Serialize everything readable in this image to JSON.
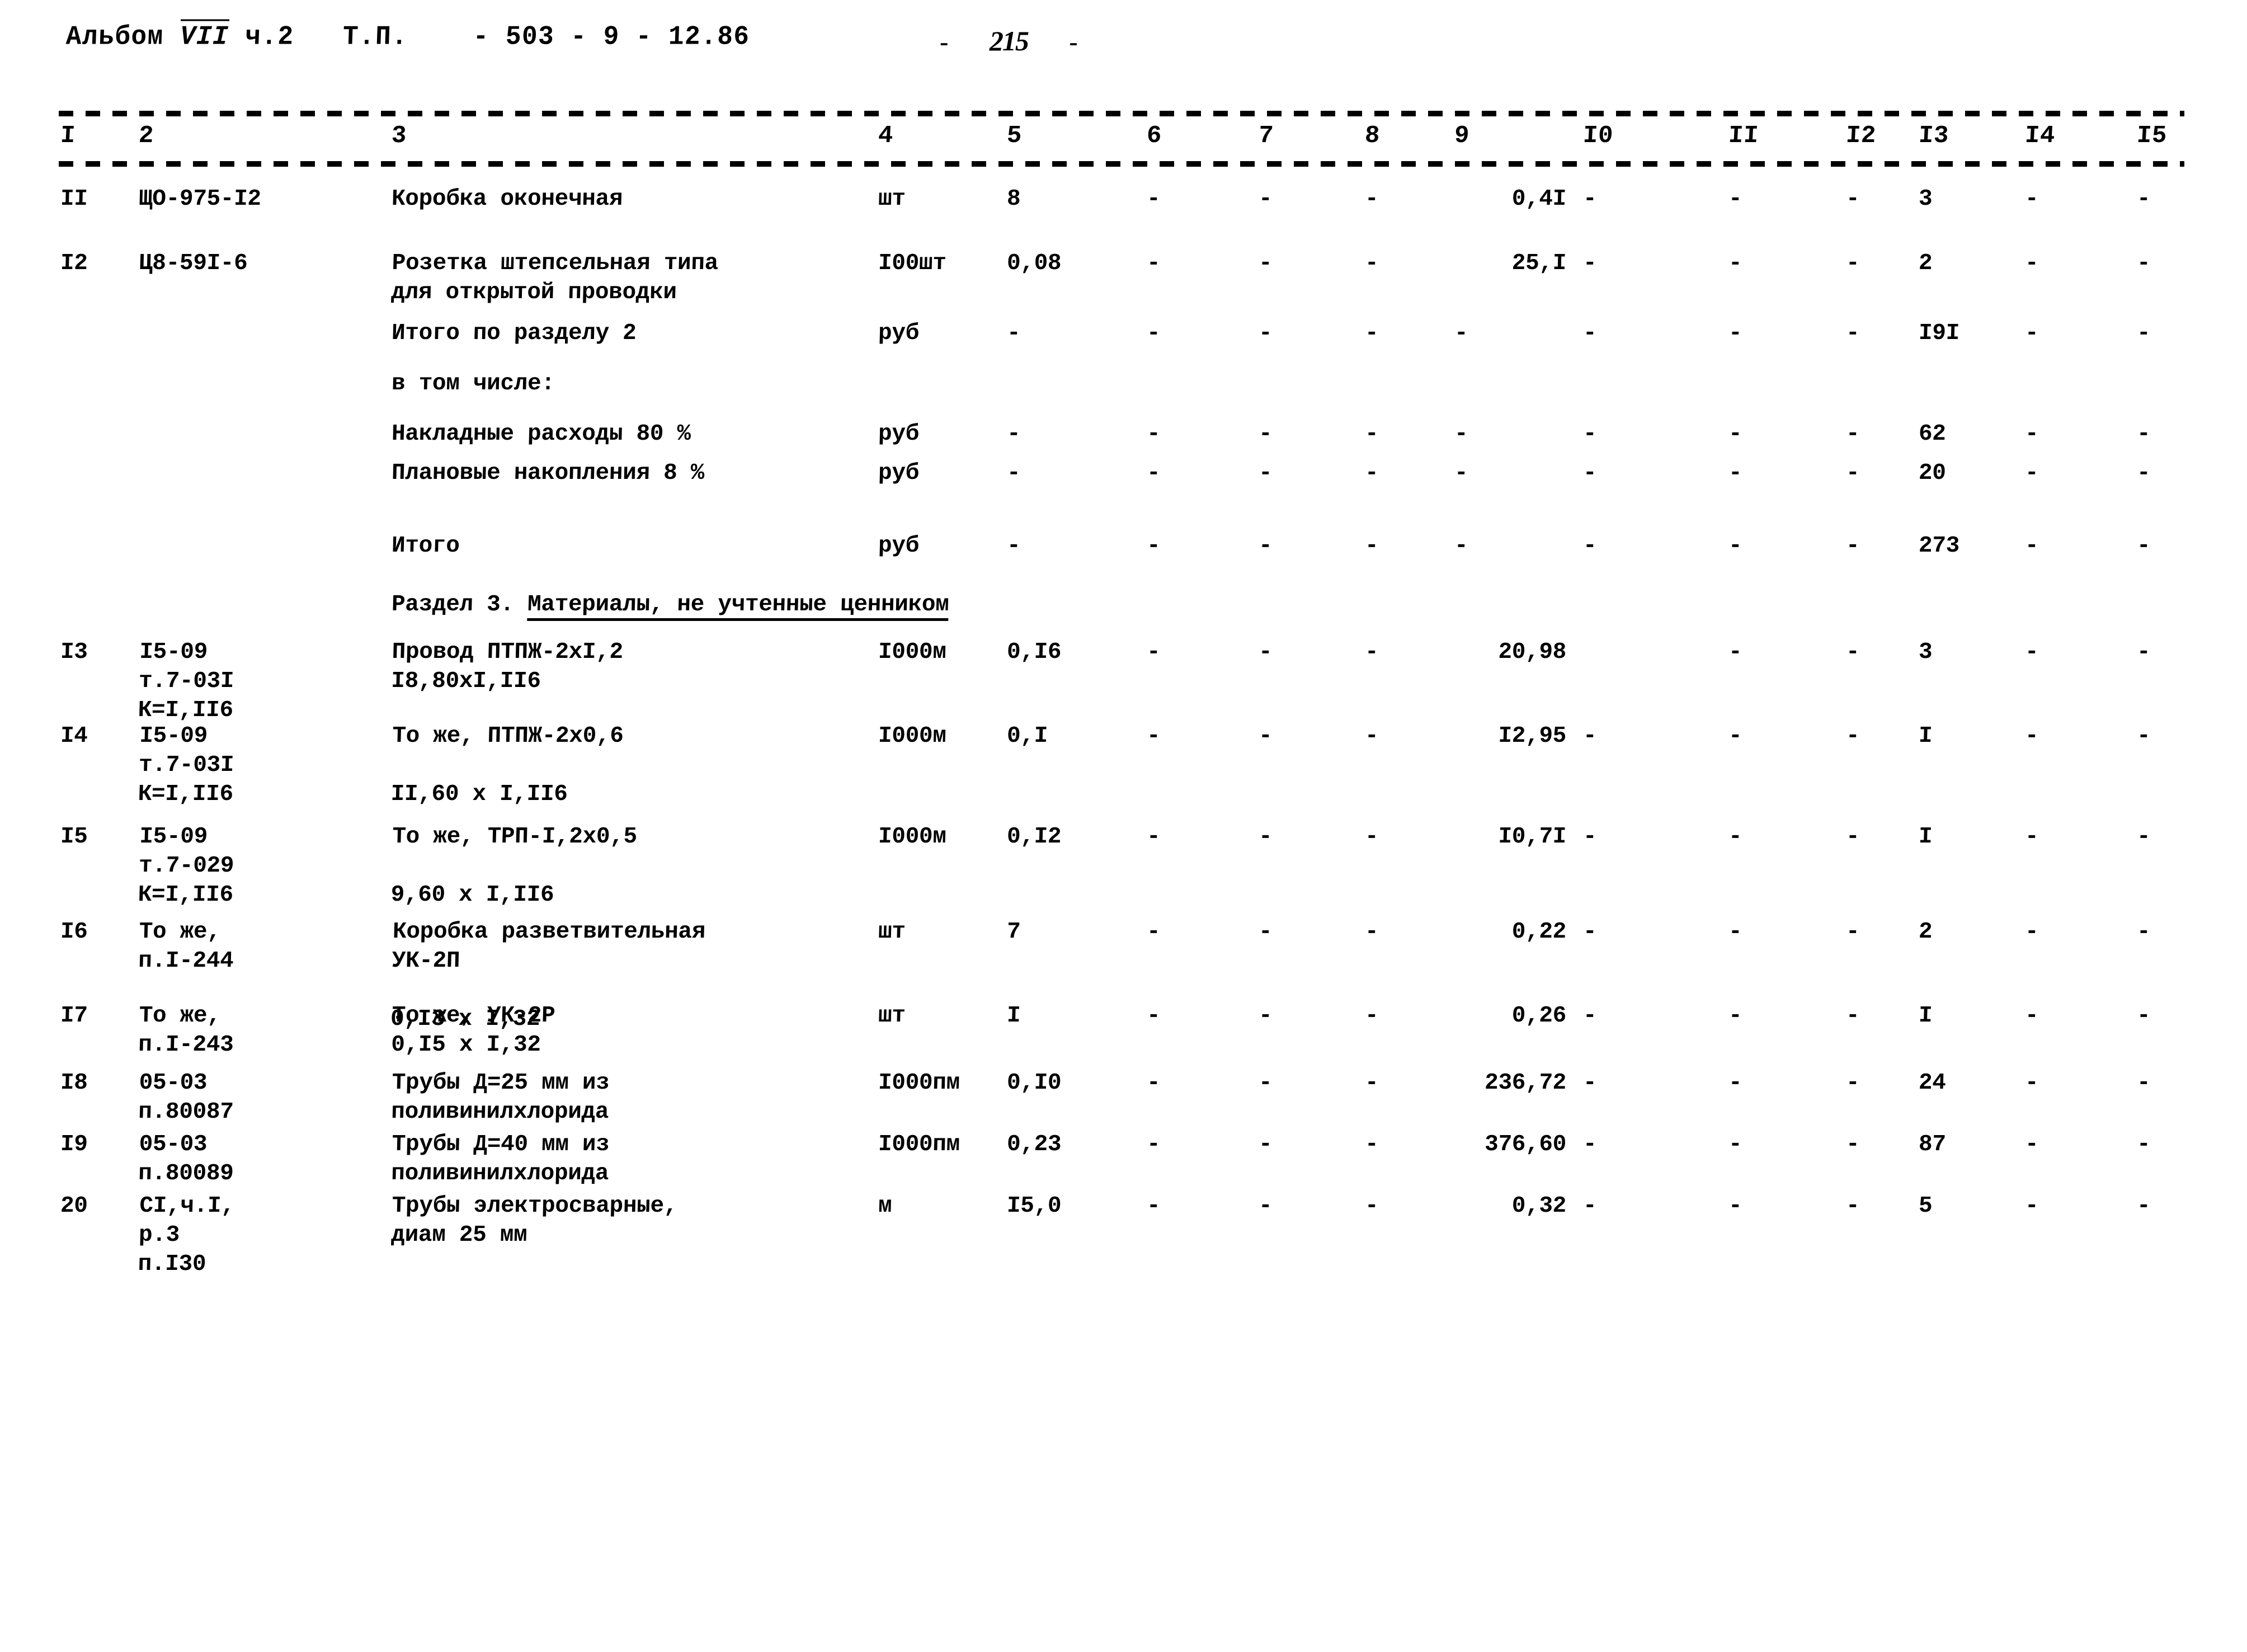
{
  "header": {
    "album_prefix": "Альбом",
    "album_roman": "VII",
    "album_part": "ч.2",
    "doc_type": "Т.П.",
    "doc_code": "- 503 - 9 - 12.86",
    "page_dash_left": "-",
    "page_number": "215",
    "page_dash_right": "-"
  },
  "columns": [
    "I",
    "2",
    "3",
    "4",
    "5",
    "6",
    "7",
    "8",
    "9",
    "I0",
    "II",
    "I2",
    "I3",
    "I4",
    "I5"
  ],
  "dash": "-",
  "section_heading": {
    "prefix": "Раздел 3. ",
    "underlined": "Материалы, не учтенные ценником"
  },
  "rows": [
    {
      "n": "II",
      "code": "ЩО-975-I2",
      "name": "Коробка оконечная",
      "unit": "шт",
      "qty": "8",
      "c6": "-",
      "c7": "-",
      "c8": "-",
      "c9": "0,4I",
      "c10": "-",
      "c11": "-",
      "c12": "-",
      "c13": "3",
      "c14": "-",
      "c15": "-"
    },
    {
      "n": "I2",
      "code": "Ц8-59I-6",
      "name": "Розетка штепсельная типа",
      "name2": "для открытой проводки",
      "unit": "I00шт",
      "qty": "0,08",
      "c6": "-",
      "c7": "-",
      "c8": "-",
      "c9": "25,I",
      "c10": "-",
      "c11": "-",
      "c12": "-",
      "c13": "2",
      "c14": "-",
      "c15": "-"
    },
    {
      "n": "",
      "code": "",
      "name": "Итого по разделу 2",
      "unit": "руб",
      "qty": "-",
      "c6": "-",
      "c7": "-",
      "c8": "-",
      "c9": "-",
      "c10": "-",
      "c11": "-",
      "c12": "-",
      "c13": "I9I",
      "c14": "-",
      "c15": "-"
    },
    {
      "n": "",
      "code": "",
      "name": "в том числе:",
      "unit": "",
      "qty": "",
      "c6": "",
      "c7": "",
      "c8": "",
      "c9": "",
      "c10": "",
      "c11": "",
      "c12": "",
      "c13": "",
      "c14": "",
      "c15": ""
    },
    {
      "n": "",
      "code": "",
      "name": "Накладные расходы 80 %",
      "unit": "руб",
      "qty": "-",
      "c6": "-",
      "c7": "-",
      "c8": "-",
      "c9": "-",
      "c10": "-",
      "c11": "-",
      "c12": "-",
      "c13": "62",
      "c14": "-",
      "c15": "-"
    },
    {
      "n": "",
      "code": "",
      "name": "Плановые накопления 8 %",
      "unit": "руб",
      "qty": "-",
      "c6": "-",
      "c7": "-",
      "c8": "-",
      "c9": "-",
      "c10": "-",
      "c11": "-",
      "c12": "-",
      "c13": "20",
      "c14": "-",
      "c15": "-"
    },
    {
      "n": "",
      "code": "",
      "name": "Итого",
      "unit": "руб",
      "qty": "-",
      "c6": "-",
      "c7": "-",
      "c8": "-",
      "c9": "-",
      "c10": "-",
      "c11": "-",
      "c12": "-",
      "c13": "273",
      "c14": "-",
      "c15": "-"
    },
    {
      "n": "I3",
      "code": "I5-09",
      "code2": "т.7-03I",
      "code3": "К=I,II6",
      "name": "Провод ПТПЖ-2хI,2",
      "name2": "I8,80хI,II6",
      "unit": "I000м",
      "qty": "0,I6",
      "c6": "-",
      "c7": "-",
      "c8": "-",
      "c9": "20,98",
      "c10": "",
      "c11": "-",
      "c12": "-",
      "c13": "3",
      "c14": "-",
      "c15": "-"
    },
    {
      "n": "I4",
      "code": "I5-09",
      "code2": "т.7-03I",
      "code3": "К=I,II6",
      "name": "То же, ПТПЖ-2х0,6",
      "name3": "II,60 х I,II6",
      "unit": "I000м",
      "qty": "0,I",
      "c6": "-",
      "c7": "-",
      "c8": "-",
      "c9": "I2,95",
      "c10": "-",
      "c11": "-",
      "c12": "-",
      "c13": "I",
      "c14": "-",
      "c15": "-"
    },
    {
      "n": "I5",
      "code": "I5-09",
      "code2": "т.7-029",
      "code3": "К=I,II6",
      "name": "То же, ТРП-I,2х0,5",
      "name3": "9,60 х I,II6",
      "unit": "I000м",
      "qty": "0,I2",
      "c6": "-",
      "c7": "-",
      "c8": "-",
      "c9": "I0,7I",
      "c10": "-",
      "c11": "-",
      "c12": "-",
      "c13": "I",
      "c14": "-",
      "c15": "-"
    },
    {
      "n": "I6",
      "code": "То же,",
      "code2": "п.I-244",
      "name": "Коробка разветвительная",
      "name2": "УК-2П",
      "name3": "0,I3 х I,32",
      "unit": "шт",
      "qty": "7",
      "c6": "-",
      "c7": "-",
      "c8": "-",
      "c9": "0,22",
      "c10": "-",
      "c11": "-",
      "c12": "-",
      "c13": "2",
      "c14": "-",
      "c15": "-"
    },
    {
      "n": "I7",
      "code": "То же,",
      "code2": "п.I-243",
      "name": "То же, УК-2Р",
      "name2": "0,I5 х I,32",
      "unit": "шт",
      "qty": "I",
      "c6": "-",
      "c7": "-",
      "c8": "-",
      "c9": "0,26",
      "c10": "-",
      "c11": "-",
      "c12": "-",
      "c13": "I",
      "c14": "-",
      "c15": "-"
    },
    {
      "n": "I8",
      "code": "05-03",
      "code2": "п.80087",
      "name": "Трубы Д=25 мм из",
      "name2": "поливинилхлорида",
      "unit": "I000пм",
      "qty": "0,I0",
      "c6": "-",
      "c7": "-",
      "c8": "-",
      "c9": "236,72",
      "c10": "-",
      "c11": "-",
      "c12": "-",
      "c13": "24",
      "c14": "-",
      "c15": "-"
    },
    {
      "n": "I9",
      "code": "05-03",
      "code2": "п.80089",
      "name": "Трубы Д=40 мм из",
      "name2": "поливинилхлорида",
      "unit": "I000пм",
      "qty": "0,23",
      "c6": "-",
      "c7": "-",
      "c8": "-",
      "c9": "376,60",
      "c10": "-",
      "c11": "-",
      "c12": "-",
      "c13": "87",
      "c14": "-",
      "c15": "-"
    },
    {
      "n": "20",
      "code": "CI,ч.I,",
      "code2": "р.3",
      "code3": "п.I30",
      "name": "Трубы электросварные,",
      "name2": "диам 25 мм",
      "unit": "м",
      "qty": "I5,0",
      "c6": "-",
      "c7": "-",
      "c8": "-",
      "c9": "0,32",
      "c10": "-",
      "c11": "-",
      "c12": "-",
      "c13": "5",
      "c14": "-",
      "c15": "-"
    }
  ]
}
